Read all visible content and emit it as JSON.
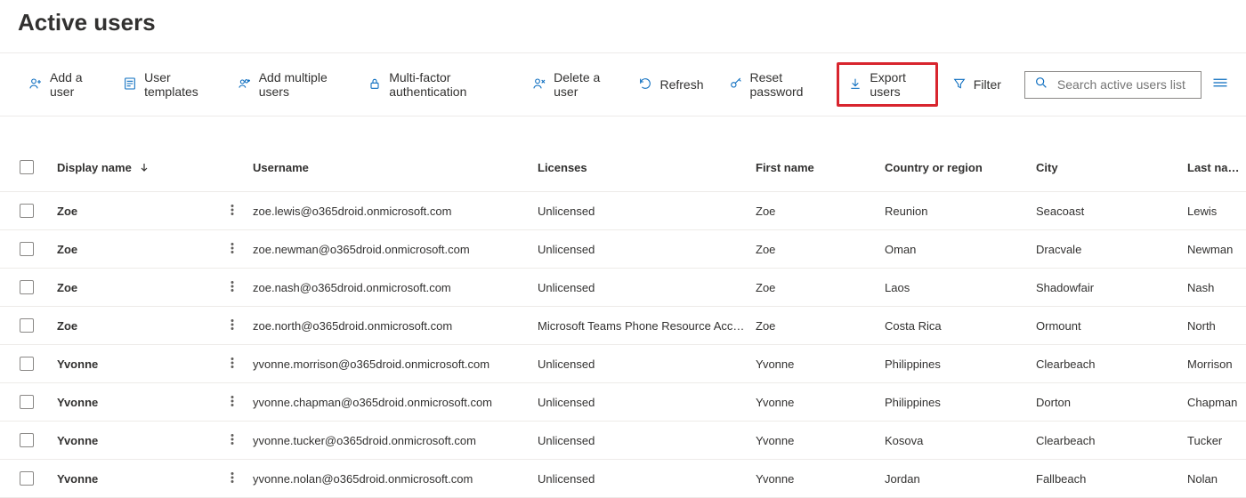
{
  "page": {
    "title": "Active users"
  },
  "toolbar": {
    "add_user": "Add a user",
    "user_templates": "User templates",
    "add_multiple": "Add multiple users",
    "mfa": "Multi-factor authentication",
    "delete_user": "Delete a user",
    "refresh": "Refresh",
    "reset_password": "Reset password",
    "export_users": "Export users",
    "filter": "Filter",
    "search_placeholder": "Search active users list"
  },
  "columns": {
    "display_name": "Display name",
    "username": "Username",
    "licenses": "Licenses",
    "first_name": "First name",
    "country": "Country or region",
    "city": "City",
    "last_name": "Last name"
  },
  "rows": [
    {
      "display_name": "Zoe",
      "username": "zoe.lewis@o365droid.onmicrosoft.com",
      "licenses": "Unlicensed",
      "first_name": "Zoe",
      "country": "Reunion",
      "city": "Seacoast",
      "last_name": "Lewis"
    },
    {
      "display_name": "Zoe",
      "username": "zoe.newman@o365droid.onmicrosoft.com",
      "licenses": "Unlicensed",
      "first_name": "Zoe",
      "country": "Oman",
      "city": "Dracvale",
      "last_name": "Newman"
    },
    {
      "display_name": "Zoe",
      "username": "zoe.nash@o365droid.onmicrosoft.com",
      "licenses": "Unlicensed",
      "first_name": "Zoe",
      "country": "Laos",
      "city": "Shadowfair",
      "last_name": "Nash"
    },
    {
      "display_name": "Zoe",
      "username": "zoe.north@o365droid.onmicrosoft.com",
      "licenses": "Microsoft Teams Phone Resource Account",
      "first_name": "Zoe",
      "country": "Costa Rica",
      "city": "Ormount",
      "last_name": "North"
    },
    {
      "display_name": "Yvonne",
      "username": "yvonne.morrison@o365droid.onmicrosoft.com",
      "licenses": "Unlicensed",
      "first_name": "Yvonne",
      "country": "Philippines",
      "city": "Clearbeach",
      "last_name": "Morrison"
    },
    {
      "display_name": "Yvonne",
      "username": "yvonne.chapman@o365droid.onmicrosoft.com",
      "licenses": "Unlicensed",
      "first_name": "Yvonne",
      "country": "Philippines",
      "city": "Dorton",
      "last_name": "Chapman"
    },
    {
      "display_name": "Yvonne",
      "username": "yvonne.tucker@o365droid.onmicrosoft.com",
      "licenses": "Unlicensed",
      "first_name": "Yvonne",
      "country": "Kosova",
      "city": "Clearbeach",
      "last_name": "Tucker"
    },
    {
      "display_name": "Yvonne",
      "username": "yvonne.nolan@o365droid.onmicrosoft.com",
      "licenses": "Unlicensed",
      "first_name": "Yvonne",
      "country": "Jordan",
      "city": "Fallbeach",
      "last_name": "Nolan"
    }
  ]
}
